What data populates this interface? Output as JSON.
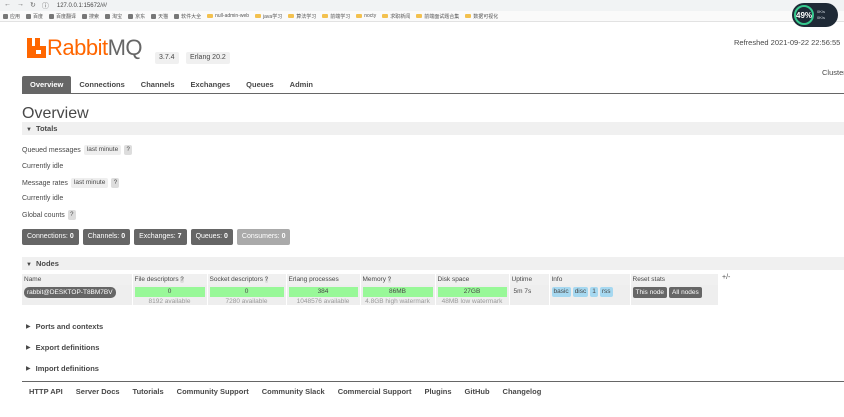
{
  "browser": {
    "url": "127.0.0.1:15672/#/",
    "bookmarks": [
      "应用",
      "百度",
      "百度翻译",
      "搜索",
      "淘宝",
      "京东",
      "天猫",
      "软件大全",
      "null-admin-web",
      "java学习",
      "算法学习",
      "前端学习",
      "nocty",
      "求职新闻",
      "前端面试题合集",
      "数据可视化"
    ],
    "widget": {
      "percent": "49%",
      "stat1": "0K/s",
      "stat2": "0K/s"
    }
  },
  "header": {
    "logo_rabbit": "Rabbit",
    "logo_mq": "MQ",
    "version": "3.7.4",
    "erlang": "Erlang 20.2",
    "refreshed": "Refreshed 2021-09-22 22:56:55",
    "cluster": "Cluster"
  },
  "tabs": [
    "Overview",
    "Connections",
    "Channels",
    "Exchanges",
    "Queues",
    "Admin"
  ],
  "page_title": "Overview",
  "totals": {
    "title": "Totals",
    "queued_messages": "Queued messages",
    "last_minute": "last minute",
    "help": "?",
    "idle1": "Currently idle",
    "message_rates": "Message rates",
    "idle2": "Currently idle",
    "global_counts": "Global counts"
  },
  "counters": [
    {
      "label": "Connections:",
      "value": "0"
    },
    {
      "label": "Channels:",
      "value": "0"
    },
    {
      "label": "Exchanges:",
      "value": "7"
    },
    {
      "label": "Queues:",
      "value": "0"
    },
    {
      "label": "Consumers:",
      "value": "0"
    }
  ],
  "nodes": {
    "title": "Nodes",
    "plusminus": "+/-",
    "headers": [
      "Name",
      "File descriptors",
      "Socket descriptors",
      "Erlang processes",
      "Memory",
      "Disk space",
      "Uptime",
      "Info",
      "Reset stats"
    ],
    "row": {
      "name": "rabbit@DESKTOP-T8BM7BV",
      "fd": "0",
      "fd_sub": "8192 available",
      "sd": "0",
      "sd_sub": "7280 available",
      "ep": "384",
      "ep_sub": "1048576 available",
      "mem": "86MB",
      "mem_sub": "4.8GB high watermark",
      "disk": "27GB",
      "disk_sub": "48MB low watermark",
      "uptime": "5m 7s",
      "info": [
        "basic",
        "disc",
        "1",
        "rss"
      ],
      "reset": [
        "This node",
        "All nodes"
      ]
    }
  },
  "sections": [
    "Ports and contexts",
    "Export definitions",
    "Import definitions"
  ],
  "footer": [
    "HTTP API",
    "Server Docs",
    "Tutorials",
    "Community Support",
    "Community Slack",
    "Commercial Support",
    "Plugins",
    "GitHub",
    "Changelog"
  ]
}
